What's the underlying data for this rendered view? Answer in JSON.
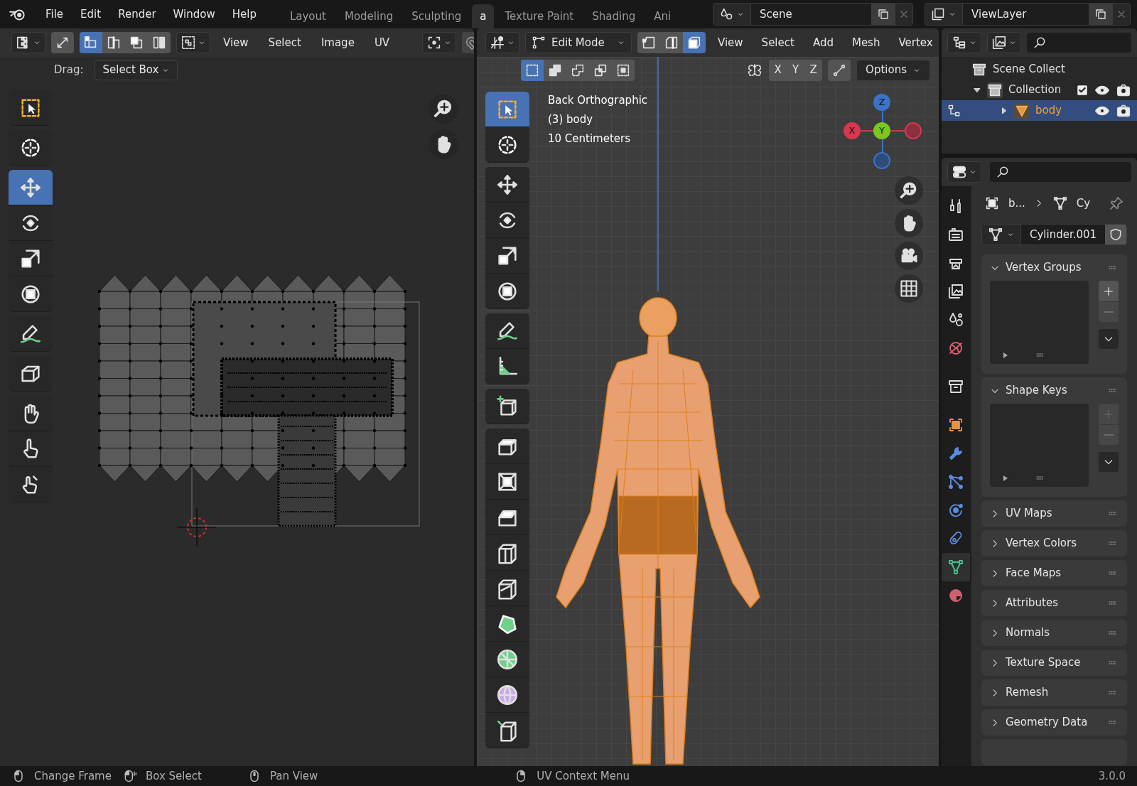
{
  "topbar": {
    "menus": [
      "File",
      "Edit",
      "Render",
      "Window",
      "Help"
    ],
    "workspaces": [
      {
        "label": "Layout",
        "selected": false
      },
      {
        "label": "Modeling",
        "selected": false
      },
      {
        "label": "Sculpting",
        "selected": false
      },
      {
        "label": "a",
        "selected": true
      },
      {
        "label": "Texture Paint",
        "selected": false
      },
      {
        "label": "Shading",
        "selected": false
      },
      {
        "label": "Ani",
        "selected": false
      }
    ],
    "scene": "Scene",
    "view_layer": "ViewLayer"
  },
  "uv_editor": {
    "select_modes": [
      {
        "selected": true
      },
      {
        "selected": false
      },
      {
        "selected": false
      },
      {
        "selected": false
      }
    ],
    "menus": [
      "View",
      "Select",
      "Image",
      "UV"
    ],
    "drag_label": "Drag:",
    "drag_value": "Select Box",
    "tools": [
      [
        {
          "kind": "select-box",
          "selected": false
        }
      ],
      [
        {
          "kind": "cursor",
          "selected": false
        }
      ],
      [
        {
          "kind": "move",
          "selected": true
        },
        {
          "kind": "rotate",
          "selected": false
        },
        {
          "kind": "scale",
          "selected": false
        },
        {
          "kind": "transform",
          "selected": false
        }
      ],
      [
        {
          "kind": "annotate",
          "selected": false
        }
      ],
      [
        {
          "kind": "rip",
          "selected": false
        }
      ],
      [
        {
          "kind": "grab",
          "selected": false
        },
        {
          "kind": "relax",
          "selected": false
        },
        {
          "kind": "pinch",
          "selected": false
        }
      ]
    ]
  },
  "viewport": {
    "mode": "Edit Mode",
    "select_modes": [
      {
        "selected": false
      },
      {
        "selected": false
      },
      {
        "selected": true
      }
    ],
    "menus": [
      "View",
      "Select",
      "Add",
      "Mesh",
      "Vertex"
    ],
    "box_modes": [
      {
        "selected": true
      },
      {
        "selected": false
      },
      {
        "selected": false
      },
      {
        "selected": false
      },
      {
        "selected": false
      }
    ],
    "axes": [
      "X",
      "Y",
      "Z"
    ],
    "options": "Options",
    "overlay": [
      "Back Orthographic",
      "(3) body",
      "10 Centimeters"
    ],
    "gizmo": {
      "x": "X",
      "y": "Y",
      "z": "Z"
    },
    "tools": [
      [
        {
          "kind": "select-box",
          "selected": true
        },
        {
          "kind": "cursor",
          "selected": false
        }
      ],
      [
        {
          "kind": "move",
          "selected": false
        },
        {
          "kind": "rotate",
          "selected": false
        },
        {
          "kind": "scale",
          "selected": false
        },
        {
          "kind": "transform",
          "selected": false
        }
      ],
      [
        {
          "kind": "annotate",
          "selected": false
        },
        {
          "kind": "measure",
          "selected": false
        }
      ],
      [
        {
          "kind": "add-cube",
          "selected": false
        }
      ],
      [
        {
          "kind": "extrude",
          "selected": false
        },
        {
          "kind": "inset",
          "selected": false
        },
        {
          "kind": "bevel",
          "selected": false
        },
        {
          "kind": "loop-cut",
          "selected": false
        },
        {
          "kind": "knife",
          "selected": false
        },
        {
          "kind": "poly-build",
          "selected": false
        },
        {
          "kind": "spin",
          "selected": false
        },
        {
          "kind": "smooth",
          "selected": false
        },
        {
          "kind": "shear",
          "selected": false
        }
      ]
    ]
  },
  "outliner": {
    "items": [
      {
        "label": "Scene Collect",
        "children": [
          {
            "label": "Collection",
            "expanded": true,
            "checked": true,
            "selected": false,
            "children": [
              {
                "label": "body",
                "expanded": false,
                "selected": true
              }
            ]
          }
        ]
      }
    ]
  },
  "properties": {
    "tabs": [
      [
        {
          "kind": "tool",
          "selected": false
        },
        {
          "kind": "render",
          "selected": false
        },
        {
          "kind": "output",
          "selected": false
        },
        {
          "kind": "view-layer",
          "selected": false
        },
        {
          "kind": "scene",
          "selected": false
        },
        {
          "kind": "world",
          "selected": false
        }
      ],
      [
        {
          "kind": "collection",
          "selected": false
        }
      ],
      [
        {
          "kind": "object",
          "selected": false
        },
        {
          "kind": "modifier",
          "selected": false
        },
        {
          "kind": "particles",
          "selected": false
        },
        {
          "kind": "physics",
          "selected": false
        },
        {
          "kind": "constraints",
          "selected": false
        },
        {
          "kind": "data",
          "selected": true
        },
        {
          "kind": "material",
          "selected": false
        }
      ]
    ],
    "breadcrumb": [
      "b...",
      "Cy"
    ],
    "mesh_name": "Cylinder.001",
    "panels": [
      {
        "title": "Vertex Groups",
        "expanded": true,
        "add_enabled": true
      },
      {
        "title": "Shape Keys",
        "expanded": true,
        "add_enabled": false
      },
      {
        "title": "UV Maps",
        "expanded": false
      },
      {
        "title": "Vertex Colors",
        "expanded": false
      },
      {
        "title": "Face Maps",
        "expanded": false
      },
      {
        "title": "Attributes",
        "expanded": false
      },
      {
        "title": "Normals",
        "expanded": false
      },
      {
        "title": "Texture Space",
        "expanded": false
      },
      {
        "title": "Remesh",
        "expanded": false
      },
      {
        "title": "Geometry Data",
        "expanded": false
      }
    ]
  },
  "status_bar": {
    "hints": [
      {
        "kind": "left",
        "label": "Change Frame"
      },
      {
        "kind": "drag",
        "label": "Box Select"
      },
      {
        "kind": "middle",
        "label": "Pan View"
      },
      {
        "kind": "right",
        "label": "UV Context Menu"
      }
    ],
    "version": "3.0.0"
  }
}
